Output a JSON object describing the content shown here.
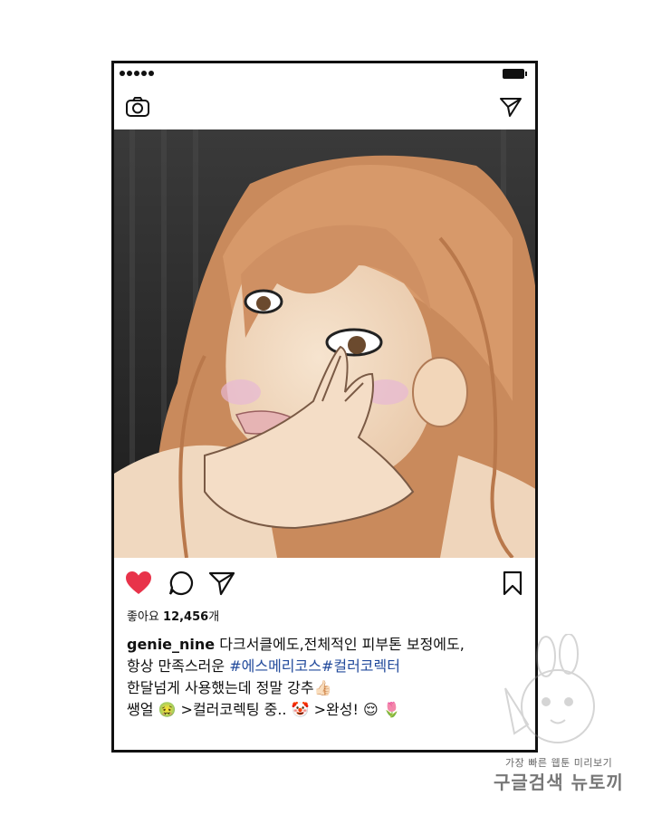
{
  "post": {
    "likes_label": "좋아요",
    "likes_count": "12,456",
    "likes_unit": "개",
    "username": "genie_nine",
    "caption_line1": "다크서클에도,전체적인 피부톤 보정에도,",
    "caption_line2_text": "항상 만족스러운 ",
    "hashtags": "#에스메리코스#컬러코렉터",
    "caption_line3": "한달넘게 사용했는데 정말 강추",
    "caption_line4_a": "쌩얼 ",
    "caption_line4_b": " >컬러코렉팅 중.. ",
    "caption_line4_c": " >완성! ",
    "emoji_thumbs": "👍🏻",
    "emoji_sick": "🤢",
    "emoji_clown": "🤡",
    "emoji_relieved": "😌",
    "emoji_tulip": "🌷"
  },
  "icons": {
    "camera": "camera-icon",
    "send": "send-icon",
    "heart": "heart-icon",
    "comment": "comment-icon",
    "share": "share-icon",
    "bookmark": "bookmark-icon"
  },
  "watermark": {
    "line1": "가장 빠른 웹툰 미리보기",
    "line2": "구글검색 뉴토끼"
  },
  "colors": {
    "heart": "#e8334a",
    "hashtag": "#234b9c"
  }
}
